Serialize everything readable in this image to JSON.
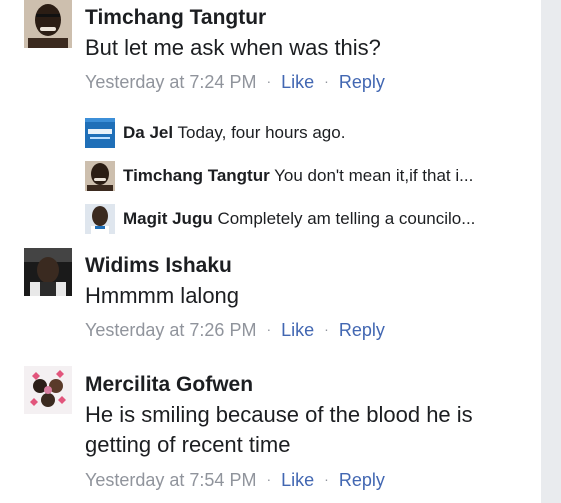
{
  "comments": [
    {
      "author": "Timchang Tangtur",
      "text": "But let me ask when was this?",
      "time": "Yesterday at 7:24 PM",
      "like": "Like",
      "reply": "Reply"
    },
    {
      "author": "Widims Ishaku",
      "text": "Hmmmm lalong",
      "time": "Yesterday at 7:26 PM",
      "like": "Like",
      "reply": "Reply"
    },
    {
      "author": "Mercilita Gofwen",
      "text": "He is smiling because of the blood he is getting of recent time",
      "time": "Yesterday at 7:54 PM",
      "like": "Like",
      "reply": "Reply"
    }
  ],
  "replies": [
    {
      "author": "Da Jel",
      "text": "Today, four hours ago."
    },
    {
      "author": "Timchang Tangtur",
      "text": "You don't mean it,if that i..."
    },
    {
      "author": "Magit Jugu",
      "text": "Completely am telling a councilo..."
    }
  ],
  "separator": "·",
  "colors": {
    "link": "#4267b2",
    "meta": "#90949c",
    "text": "#1c1e21"
  }
}
